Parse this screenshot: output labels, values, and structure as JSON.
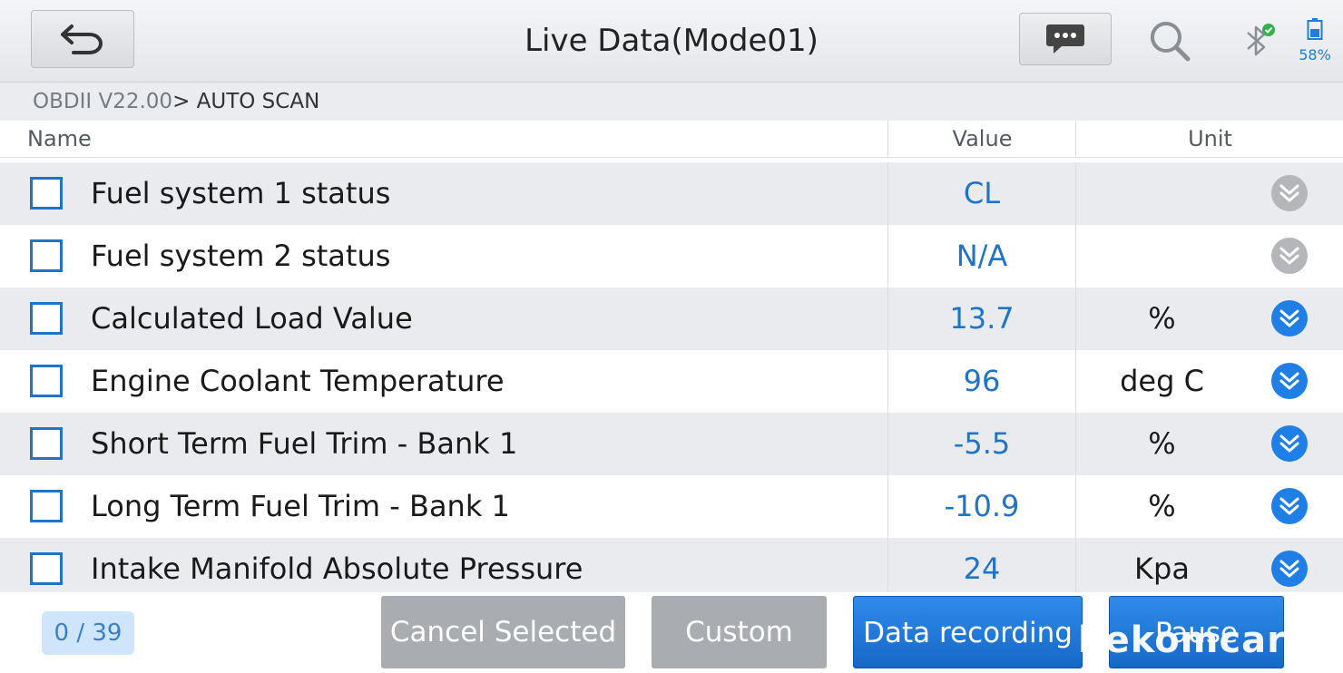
{
  "header": {
    "title": "Live Data(Mode01)",
    "battery_percent": "58%",
    "icons": {
      "back": "back-arrow-icon",
      "message": "message-icon",
      "search": "search-icon",
      "bluetooth": "bluetooth-connected-icon",
      "battery": "battery-icon"
    }
  },
  "breadcrumb": {
    "part1": "OBDII V22.00",
    "part2": "> AUTO SCAN"
  },
  "table": {
    "columns": {
      "name": "Name",
      "value": "Value",
      "unit": "Unit"
    },
    "rows": [
      {
        "name": "Fuel system 1 status",
        "value": "CL",
        "unit": "",
        "expand_state": "disabled"
      },
      {
        "name": "Fuel system 2 status",
        "value": "N/A",
        "unit": "",
        "expand_state": "disabled"
      },
      {
        "name": "Calculated Load Value",
        "value": "13.7",
        "unit": "%",
        "expand_state": "enabled"
      },
      {
        "name": "Engine Coolant Temperature",
        "value": "96",
        "unit": "deg C",
        "expand_state": "enabled"
      },
      {
        "name": "Short Term Fuel Trim - Bank 1",
        "value": "-5.5",
        "unit": "%",
        "expand_state": "enabled"
      },
      {
        "name": "Long Term Fuel Trim - Bank 1",
        "value": "-10.9",
        "unit": "%",
        "expand_state": "enabled"
      },
      {
        "name": "Intake Manifold Absolute Pressure",
        "value": "24",
        "unit": "Kpa",
        "expand_state": "enabled"
      }
    ]
  },
  "footer": {
    "counter": "0 / 39",
    "cancel_selected": "Cancel Selected",
    "custom": "Custom",
    "data_recording": "Data recording",
    "pause": "Pause",
    "watermark": "bekomcar.co"
  },
  "colors": {
    "accent_blue": "#1f74c7",
    "button_blue": "#1668c7",
    "button_gray": "#a9acb0",
    "row_shade": "#e9ebee",
    "expand_enabled": "#1f7fe6",
    "expand_disabled": "#b4b6b9"
  }
}
